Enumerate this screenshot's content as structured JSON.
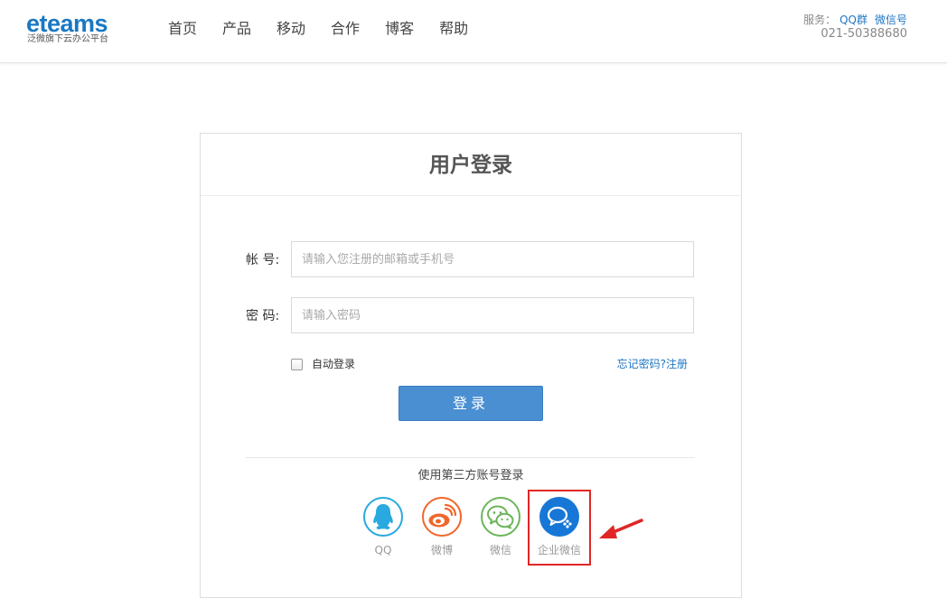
{
  "header": {
    "logo_text": "eteams",
    "logo_tagline": "泛微旗下云办公平台",
    "nav": [
      "首页",
      "产品",
      "移动",
      "合作",
      "博客",
      "帮助"
    ],
    "service_label": "服务：",
    "service_links": [
      "QQ群",
      "微信号"
    ],
    "phone": "021-50388680"
  },
  "login": {
    "title": "用户登录",
    "account_label": "帐 号:",
    "account_placeholder": "请输入您注册的邮箱或手机号",
    "password_label": "密 码:",
    "password_placeholder": "请输入密码",
    "remember_label": "自动登录",
    "forgot_link": "忘记密码?",
    "register_link": "注册",
    "submit_label": "登录",
    "third_party_title": "使用第三方账号登录",
    "third_party": [
      {
        "label": "QQ",
        "icon": "qq-icon",
        "color": "#29a9e0"
      },
      {
        "label": "微博",
        "icon": "weibo-icon",
        "color": "#f0672a"
      },
      {
        "label": "微信",
        "icon": "wechat-icon",
        "color": "#6cb55a"
      },
      {
        "label": "企业微信",
        "icon": "wecom-icon",
        "color": "#1777d6"
      }
    ]
  },
  "colors": {
    "brand": "#1a78c2",
    "link": "#1f76c4",
    "button": "#4a8fd2",
    "highlight": "#e02626"
  }
}
